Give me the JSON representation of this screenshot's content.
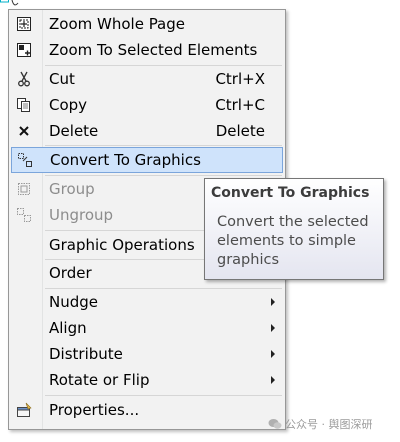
{
  "menu": {
    "items": [
      {
        "label": "Zoom Whole Page",
        "icon": "zoom-whole-page-icon"
      },
      {
        "label": "Zoom To Selected Elements",
        "icon": "zoom-selected-icon"
      },
      {
        "label": "Cut",
        "shortcut": "Ctrl+X",
        "icon": "scissors-icon"
      },
      {
        "label": "Copy",
        "shortcut": "Ctrl+C",
        "icon": "copy-icon"
      },
      {
        "label": "Delete",
        "shortcut": "Delete",
        "icon": "delete-x-icon"
      },
      {
        "label": "Convert To Graphics",
        "icon": "convert-graphics-icon",
        "highlighted": true
      },
      {
        "label": "Group",
        "icon": "group-icon",
        "disabled": true
      },
      {
        "label": "Ungroup",
        "icon": "ungroup-icon",
        "disabled": true
      },
      {
        "label": "Graphic Operations",
        "submenu": true
      },
      {
        "label": "Order",
        "submenu": true
      },
      {
        "label": "Nudge",
        "submenu": true
      },
      {
        "label": "Align",
        "submenu": true
      },
      {
        "label": "Distribute",
        "submenu": true
      },
      {
        "label": "Rotate or Flip",
        "submenu": true
      },
      {
        "label": "Properties...",
        "icon": "properties-icon"
      }
    ]
  },
  "tooltip": {
    "title": "Convert To Graphics",
    "body": "Convert the selected elements to simple graphics"
  },
  "watermark": {
    "text": "公众号 · 舆图深研"
  },
  "colors": {
    "highlight": "#cfe3fb",
    "highlight_border": "#7ba5db",
    "menu_bg": "#f2f2f2",
    "disabled_text": "#8d8d8d"
  }
}
